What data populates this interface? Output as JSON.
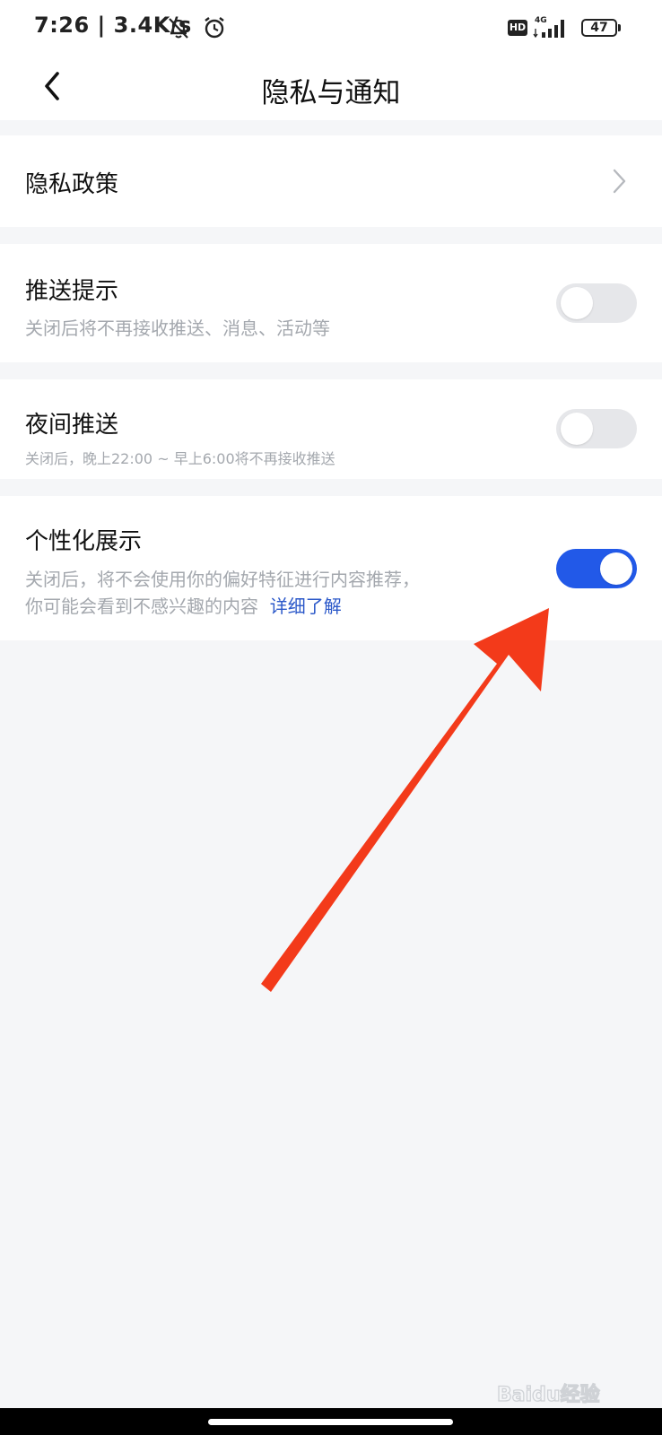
{
  "status_bar": {
    "time_speed": "7:26 | 3.4K/s",
    "hd": "HD",
    "network": "4G",
    "battery": "47"
  },
  "header": {
    "title": "隐私与通知"
  },
  "settings": {
    "privacy_policy": {
      "label": "隐私政策"
    },
    "push": {
      "label": "推送提示",
      "desc": "关闭后将不再接收推送、消息、活动等",
      "enabled": false
    },
    "night_push": {
      "label": "夜间推送",
      "desc": "关闭后，晚上22:00 ~ 早上6:00将不再接收推送",
      "enabled": false
    },
    "personalized": {
      "label": "个性化展示",
      "desc_line1": "关闭后，将不会使用你的偏好特征进行内容推荐，",
      "desc_line2": "你可能会看到不感兴趣的内容",
      "link": "详细了解",
      "enabled": true
    }
  },
  "watermark": {
    "text": "Baidu经验"
  },
  "colors": {
    "accent": "#2259e8",
    "arrow": "#f33a1a",
    "link": "#2b58c9"
  }
}
